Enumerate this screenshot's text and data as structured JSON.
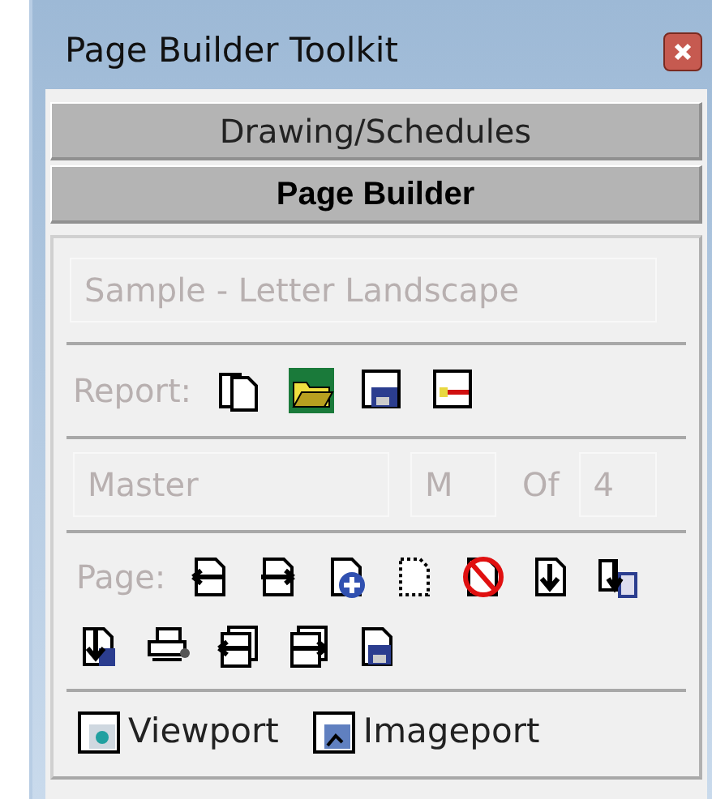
{
  "window": {
    "title": "Page Builder Toolkit"
  },
  "tabs": [
    {
      "label": "Drawing/Schedules",
      "selected": false
    },
    {
      "label": "Page Builder",
      "selected": true
    }
  ],
  "template_field": {
    "value": "Sample - Letter Landscape",
    "disabled": true
  },
  "report": {
    "label": "Report:",
    "disabled": true
  },
  "page_range": {
    "name_value": "Master",
    "start_value": "M",
    "of_label": "Of",
    "end_value": "4",
    "disabled": true
  },
  "page": {
    "label": "Page:",
    "disabled": true
  },
  "ports": [
    {
      "label": "Viewport"
    },
    {
      "label": "Imageport"
    }
  ]
}
